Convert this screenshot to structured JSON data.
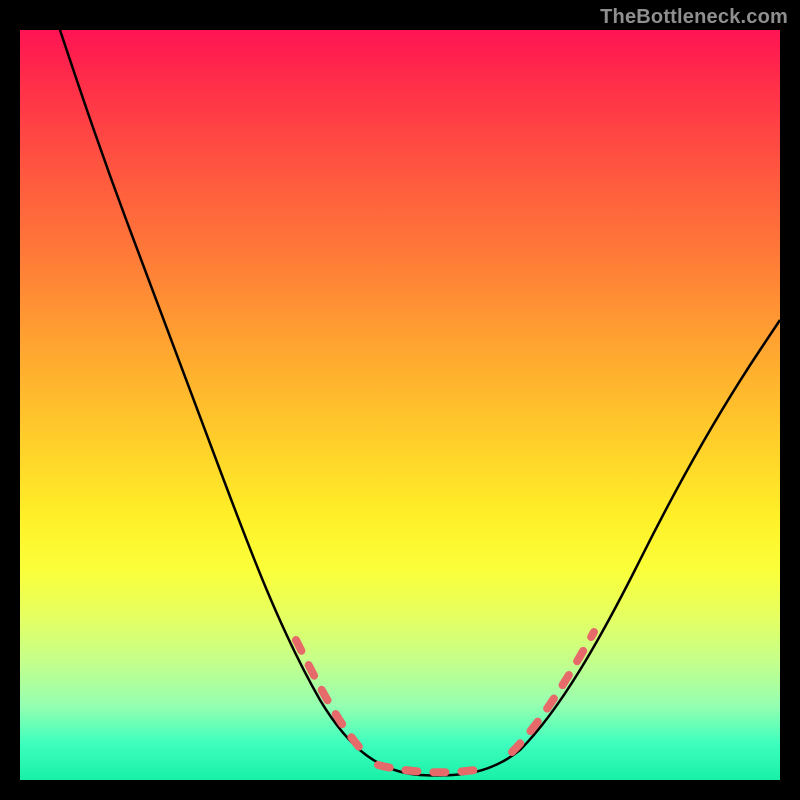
{
  "attribution": "TheBottleneck.com",
  "colors": {
    "gradient_top": "#ff1454",
    "gradient_mid": "#ffe028",
    "gradient_bottom": "#18f0a8",
    "curve": "#000000",
    "accent_dots": "#e66a6a",
    "frame_bg": "#000000"
  },
  "chart_data": {
    "type": "line",
    "title": "",
    "xlabel": "",
    "ylabel": "",
    "xlim": [
      0,
      100
    ],
    "ylim": [
      0,
      100
    ],
    "grid": false,
    "legend": false,
    "annotations": [
      "TheBottleneck.com"
    ],
    "series": [
      {
        "name": "bottleneck-curve",
        "x": [
          0,
          5,
          10,
          15,
          20,
          25,
          30,
          35,
          40,
          45,
          48,
          50,
          53,
          56,
          58,
          60,
          65,
          70,
          75,
          80,
          85,
          90,
          95,
          100
        ],
        "y": [
          100,
          94,
          86,
          76,
          66,
          56,
          46,
          36,
          26,
          16,
          10,
          6,
          3,
          1,
          0,
          0,
          1,
          4,
          9,
          16,
          24,
          33,
          43,
          53
        ]
      }
    ],
    "accent_region": {
      "description": "salmon dotted segment near curve minimum",
      "x_range": [
        40,
        72
      ],
      "y_range": [
        0,
        26
      ],
      "style": "dashed-dots"
    }
  }
}
